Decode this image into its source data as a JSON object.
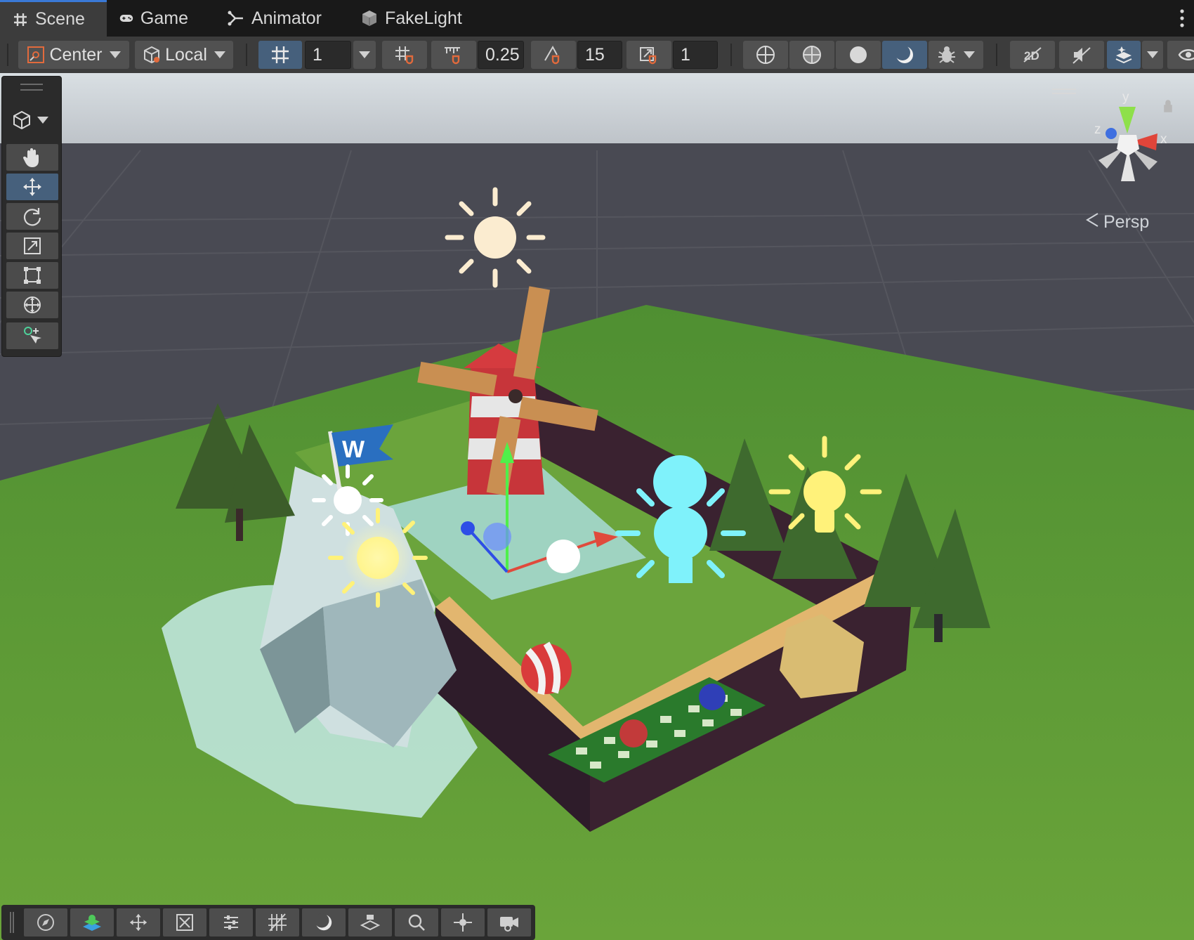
{
  "tabs": [
    {
      "label": "Scene",
      "icon": "hash-icon",
      "active": true
    },
    {
      "label": "Game",
      "icon": "gamepad-icon",
      "active": false
    },
    {
      "label": "Animator",
      "icon": "animator-icon",
      "active": false
    },
    {
      "label": "FakeLight",
      "icon": "package-icon",
      "active": false
    }
  ],
  "toolbar": {
    "pivot_label": "Center",
    "rotation_label": "Local",
    "grid_size_value": "1",
    "move_snap_value": "0.25",
    "rotate_snap_value": "15",
    "scale_snap_value": "1"
  },
  "scene": {
    "view_mode_label": "Persp",
    "gizmo_axes": {
      "y": "y",
      "x": "x",
      "z": "z"
    },
    "flag_letter": "W"
  },
  "palette_tools": [
    "view-tool",
    "move-tool",
    "rotate-tool",
    "scale-tool",
    "rect-tool",
    "transform-tool",
    "custom-tool"
  ],
  "bottom_tools": [
    "orientation",
    "layers",
    "move",
    "snap",
    "settings",
    "grid",
    "shading",
    "stack",
    "search",
    "focus",
    "camera"
  ]
}
